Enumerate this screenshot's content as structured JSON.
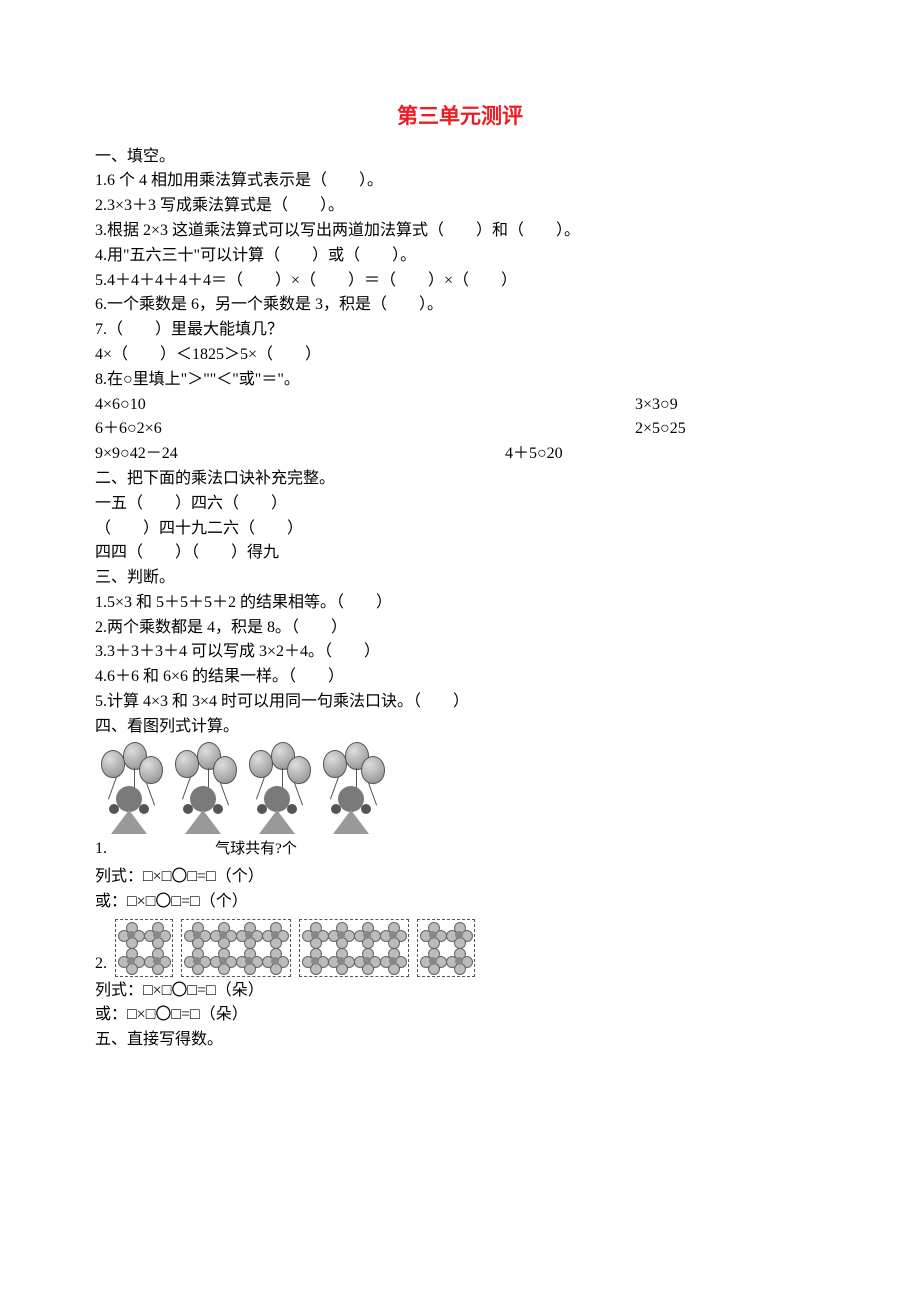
{
  "title": "第三单元测评",
  "s1": {
    "heading": "一、填空。",
    "q1": "1.6 个 4 相加用乘法算式表示是（　　）。",
    "q2": "2.3×3＋3 写成乘法算式是（　　）。",
    "q3": "3.根据 2×3 这道乘法算式可以写出两道加法算式（　　）和（　　）。",
    "q4": "4.用\"五六三十\"可以计算（　　）或（　　）。",
    "q5": "5.4＋4＋4＋4＋4＝（　　）×（　　）＝（　　）×（　　）",
    "q6": "6.一个乘数是 6，另一个乘数是 3，积是（　　）。",
    "q7": "7.（　　）里最大能填几？",
    "q7b": "4×（　　）＜1825＞5×（　　）",
    "q8": "8.在○里填上\"＞\"\"＜\"或\"＝\"。",
    "q8rows": [
      {
        "a": "4×6○10",
        "b": "3×3○9"
      },
      {
        "a": "6＋6○2×6",
        "b": "2×5○25"
      },
      {
        "a": "9×9○42－24",
        "b": "4＋5○20"
      }
    ]
  },
  "s2": {
    "heading": "二、把下面的乘法口诀补充完整。",
    "l1": "一五（　　）四六（　　）",
    "l2": "（　　）四十九二六（　　）",
    "l3": "四四（　　）（　　）得九"
  },
  "s3": {
    "heading": "三、判断。",
    "q1": "1.5×3 和 5＋5＋5＋2 的结果相等。（　　）",
    "q2": "2.两个乘数都是 4，积是 8。（　　）",
    "q3": "3.3＋3＋3＋4 可以写成 3×2＋4。（　　）",
    "q4": "4.6＋6 和 6×6 的结果一样。（　　）",
    "q5": "5.计算 4×3 和 3×4 时可以用同一句乘法口诀。（　　）"
  },
  "s4": {
    "heading": "四、看图列式计算。",
    "q1prefix": "1.",
    "balloon_label": "气球共有?个",
    "q1eq1": "列式：□×□〇□=□（个）",
    "q1eq2": "或：□×□〇□=□（个）",
    "q2prefix": "2.",
    "q2eq1": "列式：□×□〇□=□（朵）",
    "q2eq2": "或：□×□〇□=□（朵）"
  },
  "s5": {
    "heading": "五、直接写得数。"
  },
  "chart_data": [
    {
      "type": "table",
      "title": "气球图",
      "description": "4 girls each holding 3 balloons",
      "groups": 4,
      "per_group": 3,
      "question": "气球共有?个"
    },
    {
      "type": "table",
      "title": "花朵图",
      "description": "Boxes of flowers: two 2×2 boxes (4 each) and two 2×4 boxes (8 each)",
      "boxes": [
        4,
        8,
        8,
        4
      ]
    }
  ]
}
